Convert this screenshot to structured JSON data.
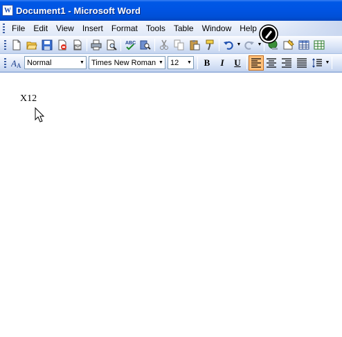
{
  "window": {
    "title": "Document1 - Microsoft Word",
    "icon": "word-doc-icon"
  },
  "menu": {
    "items": [
      {
        "label": "File",
        "key": "F"
      },
      {
        "label": "Edit",
        "key": "E"
      },
      {
        "label": "View",
        "key": "V"
      },
      {
        "label": "Insert",
        "key": "I"
      },
      {
        "label": "Format",
        "key": "o"
      },
      {
        "label": "Tools",
        "key": "T"
      },
      {
        "label": "Table",
        "key": "a"
      },
      {
        "label": "Window",
        "key": "W"
      },
      {
        "label": "Help",
        "key": "H"
      }
    ]
  },
  "standard_toolbar": {
    "buttons": [
      "new-icon",
      "open-icon",
      "save-icon",
      "permission-icon",
      "email-icon",
      "print-icon",
      "print-preview-icon",
      "spelling-icon",
      "research-icon",
      "cut-icon",
      "copy-icon",
      "paste-icon",
      "format-painter-icon",
      "undo-icon",
      "redo-icon",
      "hyperlink-icon",
      "tables-borders-icon",
      "insert-table-icon"
    ]
  },
  "formatting_toolbar": {
    "style": "Normal",
    "font": "Times New Roman",
    "size": "12",
    "bold": "B",
    "italic": "I",
    "underline": "U",
    "active_alignment": "align-left"
  },
  "document": {
    "text": "X12"
  },
  "colors": {
    "titlebar": "#0054e3",
    "active_button": "#ffc07a"
  }
}
